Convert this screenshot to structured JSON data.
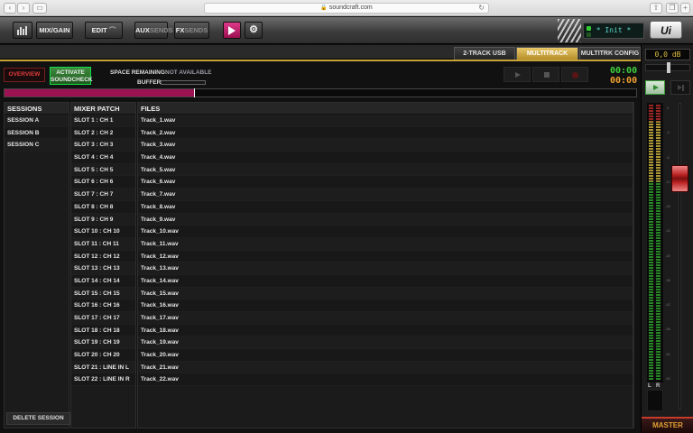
{
  "browser": {
    "url": "soundcraft.com"
  },
  "toolbar": {
    "mix_gain": "MIX/GAIN",
    "edit": "EDIT",
    "aux_prefix": "AUX",
    "aux_suffix": "SENDS",
    "fx_prefix": "FX",
    "fx_suffix": "SENDS",
    "lcd_text": "* Init *",
    "logo": "Ui"
  },
  "tabs": [
    {
      "label": "2-TRACK USB",
      "active": false
    },
    {
      "label": "MULTITRACK",
      "active": true
    },
    {
      "label": "MULTITRK CONFIG",
      "active": false
    }
  ],
  "controls": {
    "overview": "OVERVIEW",
    "activate_line1": "ACTIVATE",
    "activate_line2": "SOUNDCHECK",
    "space_label": "SPACE REMAINING:",
    "space_value": "NOT AVAILABLE",
    "buffer_label": "BUFFER:",
    "time_elapsed": "00:00",
    "time_remaining": "00:00",
    "progress": 0.3
  },
  "table": {
    "sessions_header": "SESSIONS",
    "patch_header": "MIXER PATCH",
    "files_header": "FILES",
    "sessions": [
      "SESSION A",
      "SESSION B",
      "SESSION C"
    ],
    "patch": [
      "SLOT  1  : CH 1",
      "SLOT  2  : CH 2",
      "SLOT  3  : CH 3",
      "SLOT  4  : CH 4",
      "SLOT  5  : CH 5",
      "SLOT  6  : CH 6",
      "SLOT  7  : CH 7",
      "SLOT  8  : CH 8",
      "SLOT  9  : CH 9",
      "SLOT 10 : CH 10",
      "SLOT 11 : CH 11",
      "SLOT 12 : CH 12",
      "SLOT 13 : CH 13",
      "SLOT 14 : CH 14",
      "SLOT 15 : CH 15",
      "SLOT 16 : CH 16",
      "SLOT 17 : CH 17",
      "SLOT 18 : CH 18",
      "SLOT 19 : CH 19",
      "SLOT 20 : CH 20",
      "SLOT 21 : LINE IN L",
      "SLOT 22 : LINE IN R"
    ],
    "files": [
      "Track_1.wav",
      "Track_2.wav",
      "Track_3.wav",
      "Track_4.wav",
      "Track_5.wav",
      "Track_6.wav",
      "Track_7.wav",
      "Track_8.wav",
      "Track_9.wav",
      "Track_10.wav",
      "Track_11.wav",
      "Track_12.wav",
      "Track_13.wav",
      "Track_14.wav",
      "Track_15.wav",
      "Track_16.wav",
      "Track_17.wav",
      "Track_18.wav",
      "Track_19.wav",
      "Track_20.wav",
      "Track_21.wav",
      "Track_22.wav"
    ],
    "delete_session": "DELETE SESSION"
  },
  "strip": {
    "db_value": "0,0 dB",
    "l_label": "L",
    "r_label": "R",
    "master": "MASTER",
    "scale": [
      "0",
      "-3",
      "-6",
      "-12",
      "-18",
      "-24",
      "-30",
      "-36",
      "-42",
      "-48",
      "-54",
      "-60"
    ]
  },
  "colors": {
    "accent_magenta": "#9b1352",
    "tab_gold": "#c7a338",
    "time_green": "#3fd03f",
    "time_orange": "#f0a030"
  }
}
